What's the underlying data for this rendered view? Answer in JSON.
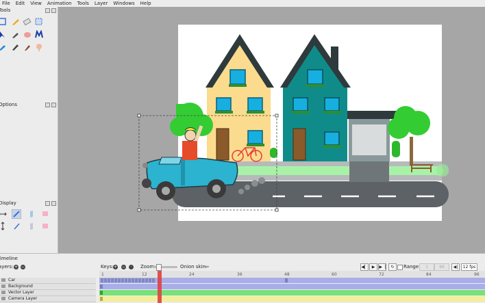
{
  "menu": [
    "File",
    "Edit",
    "View",
    "Animation",
    "Tools",
    "Layer",
    "Windows",
    "Help"
  ],
  "panels": {
    "tools_title": "Tools",
    "options_title": "Options",
    "display_title": "Display"
  },
  "timeline": {
    "title": "Timeline",
    "layers_label": "Layers:",
    "keys_label": "Keys:",
    "zoom_label": "Zoom:",
    "onion_label": "Onion skin:",
    "range_label": "Range",
    "fps": "12 fps",
    "range_start": "1",
    "range_end": "96",
    "frame_numbers": [
      "1",
      "12",
      "24",
      "36",
      "48",
      "60",
      "72",
      "84",
      "96"
    ],
    "layers": [
      {
        "name": "Car",
        "color": "#a9aee8"
      },
      {
        "name": "Background",
        "color": "#a9aee8"
      },
      {
        "name": "Vector Layer",
        "color": "#79e07a"
      },
      {
        "name": "Camera Layer",
        "color": "#f3ef9a"
      }
    ]
  },
  "colors": {
    "house_left": "#fbdb8d",
    "house_right": "#0f8c8a",
    "roof": "#2e3a3b",
    "car": "#2bb3cf",
    "road": "#5c6266",
    "tree": "#33cc33",
    "playhead": "#e04040"
  }
}
